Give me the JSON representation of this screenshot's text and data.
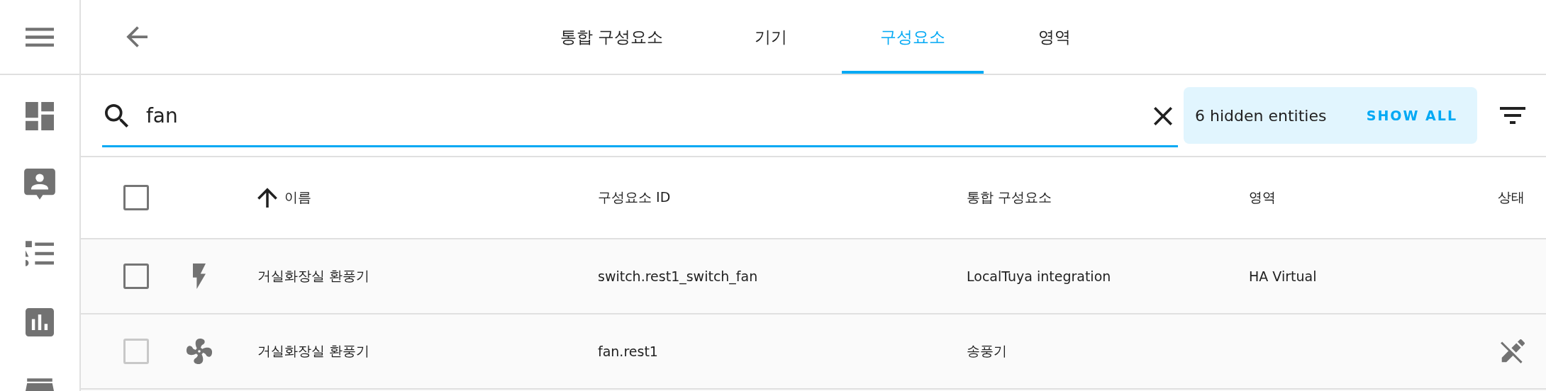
{
  "sidebar": {
    "items": [
      {
        "kind": "dashboard"
      },
      {
        "kind": "person"
      },
      {
        "kind": "list"
      },
      {
        "kind": "chart"
      },
      {
        "kind": "store"
      }
    ]
  },
  "tabs": [
    {
      "label": "통합 구성요소",
      "selected": false
    },
    {
      "label": "기기",
      "selected": false
    },
    {
      "label": "구성요소",
      "selected": true
    },
    {
      "label": "영역",
      "selected": false
    }
  ],
  "search": {
    "value": "fan"
  },
  "hidden_banner": {
    "text": "6 hidden entities",
    "action": "SHOW ALL"
  },
  "table": {
    "columns": [
      {
        "label": "이름",
        "sorted": true
      },
      {
        "label": "구성요소 ID",
        "sorted": false
      },
      {
        "label": "통합 구성요소",
        "sorted": false
      },
      {
        "label": "영역",
        "sorted": false
      },
      {
        "label": "상태",
        "sorted": false
      }
    ],
    "select_all": {
      "checked": false
    },
    "rows": [
      {
        "kind": "switch",
        "disabled": false,
        "checked": false,
        "name": "거실화장실 환풍기",
        "entity_id": "switch.rest1_switch_fan",
        "integration": "LocalTuya integration",
        "area": "HA Virtual",
        "read_only": false
      },
      {
        "kind": "fan",
        "disabled": true,
        "checked": false,
        "name": "거실화장실 환풍기",
        "entity_id": "fan.rest1",
        "integration": "송풍기",
        "read_only": true
      }
    ]
  }
}
